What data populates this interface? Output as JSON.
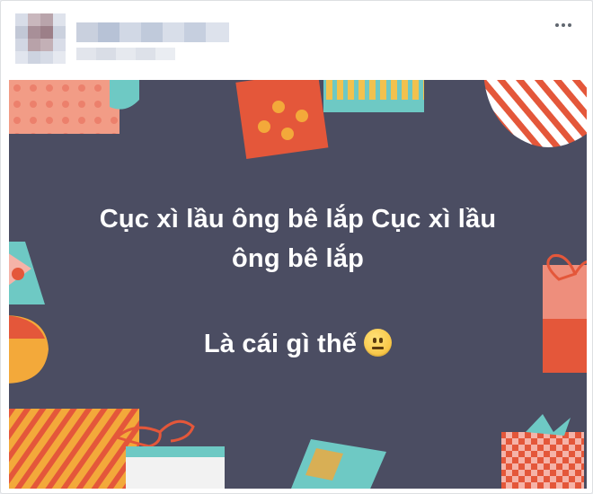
{
  "post": {
    "menu_icon": "more-horizontal-icon",
    "background_color": "#4b4d62",
    "text_line_1": "Cục xì lầu ông bê lắp Cục xì lầu",
    "text_line_2": "ông bê lắp",
    "text_line_3": "Là cái gì thế",
    "emoji": "neutral-face-emoji"
  }
}
